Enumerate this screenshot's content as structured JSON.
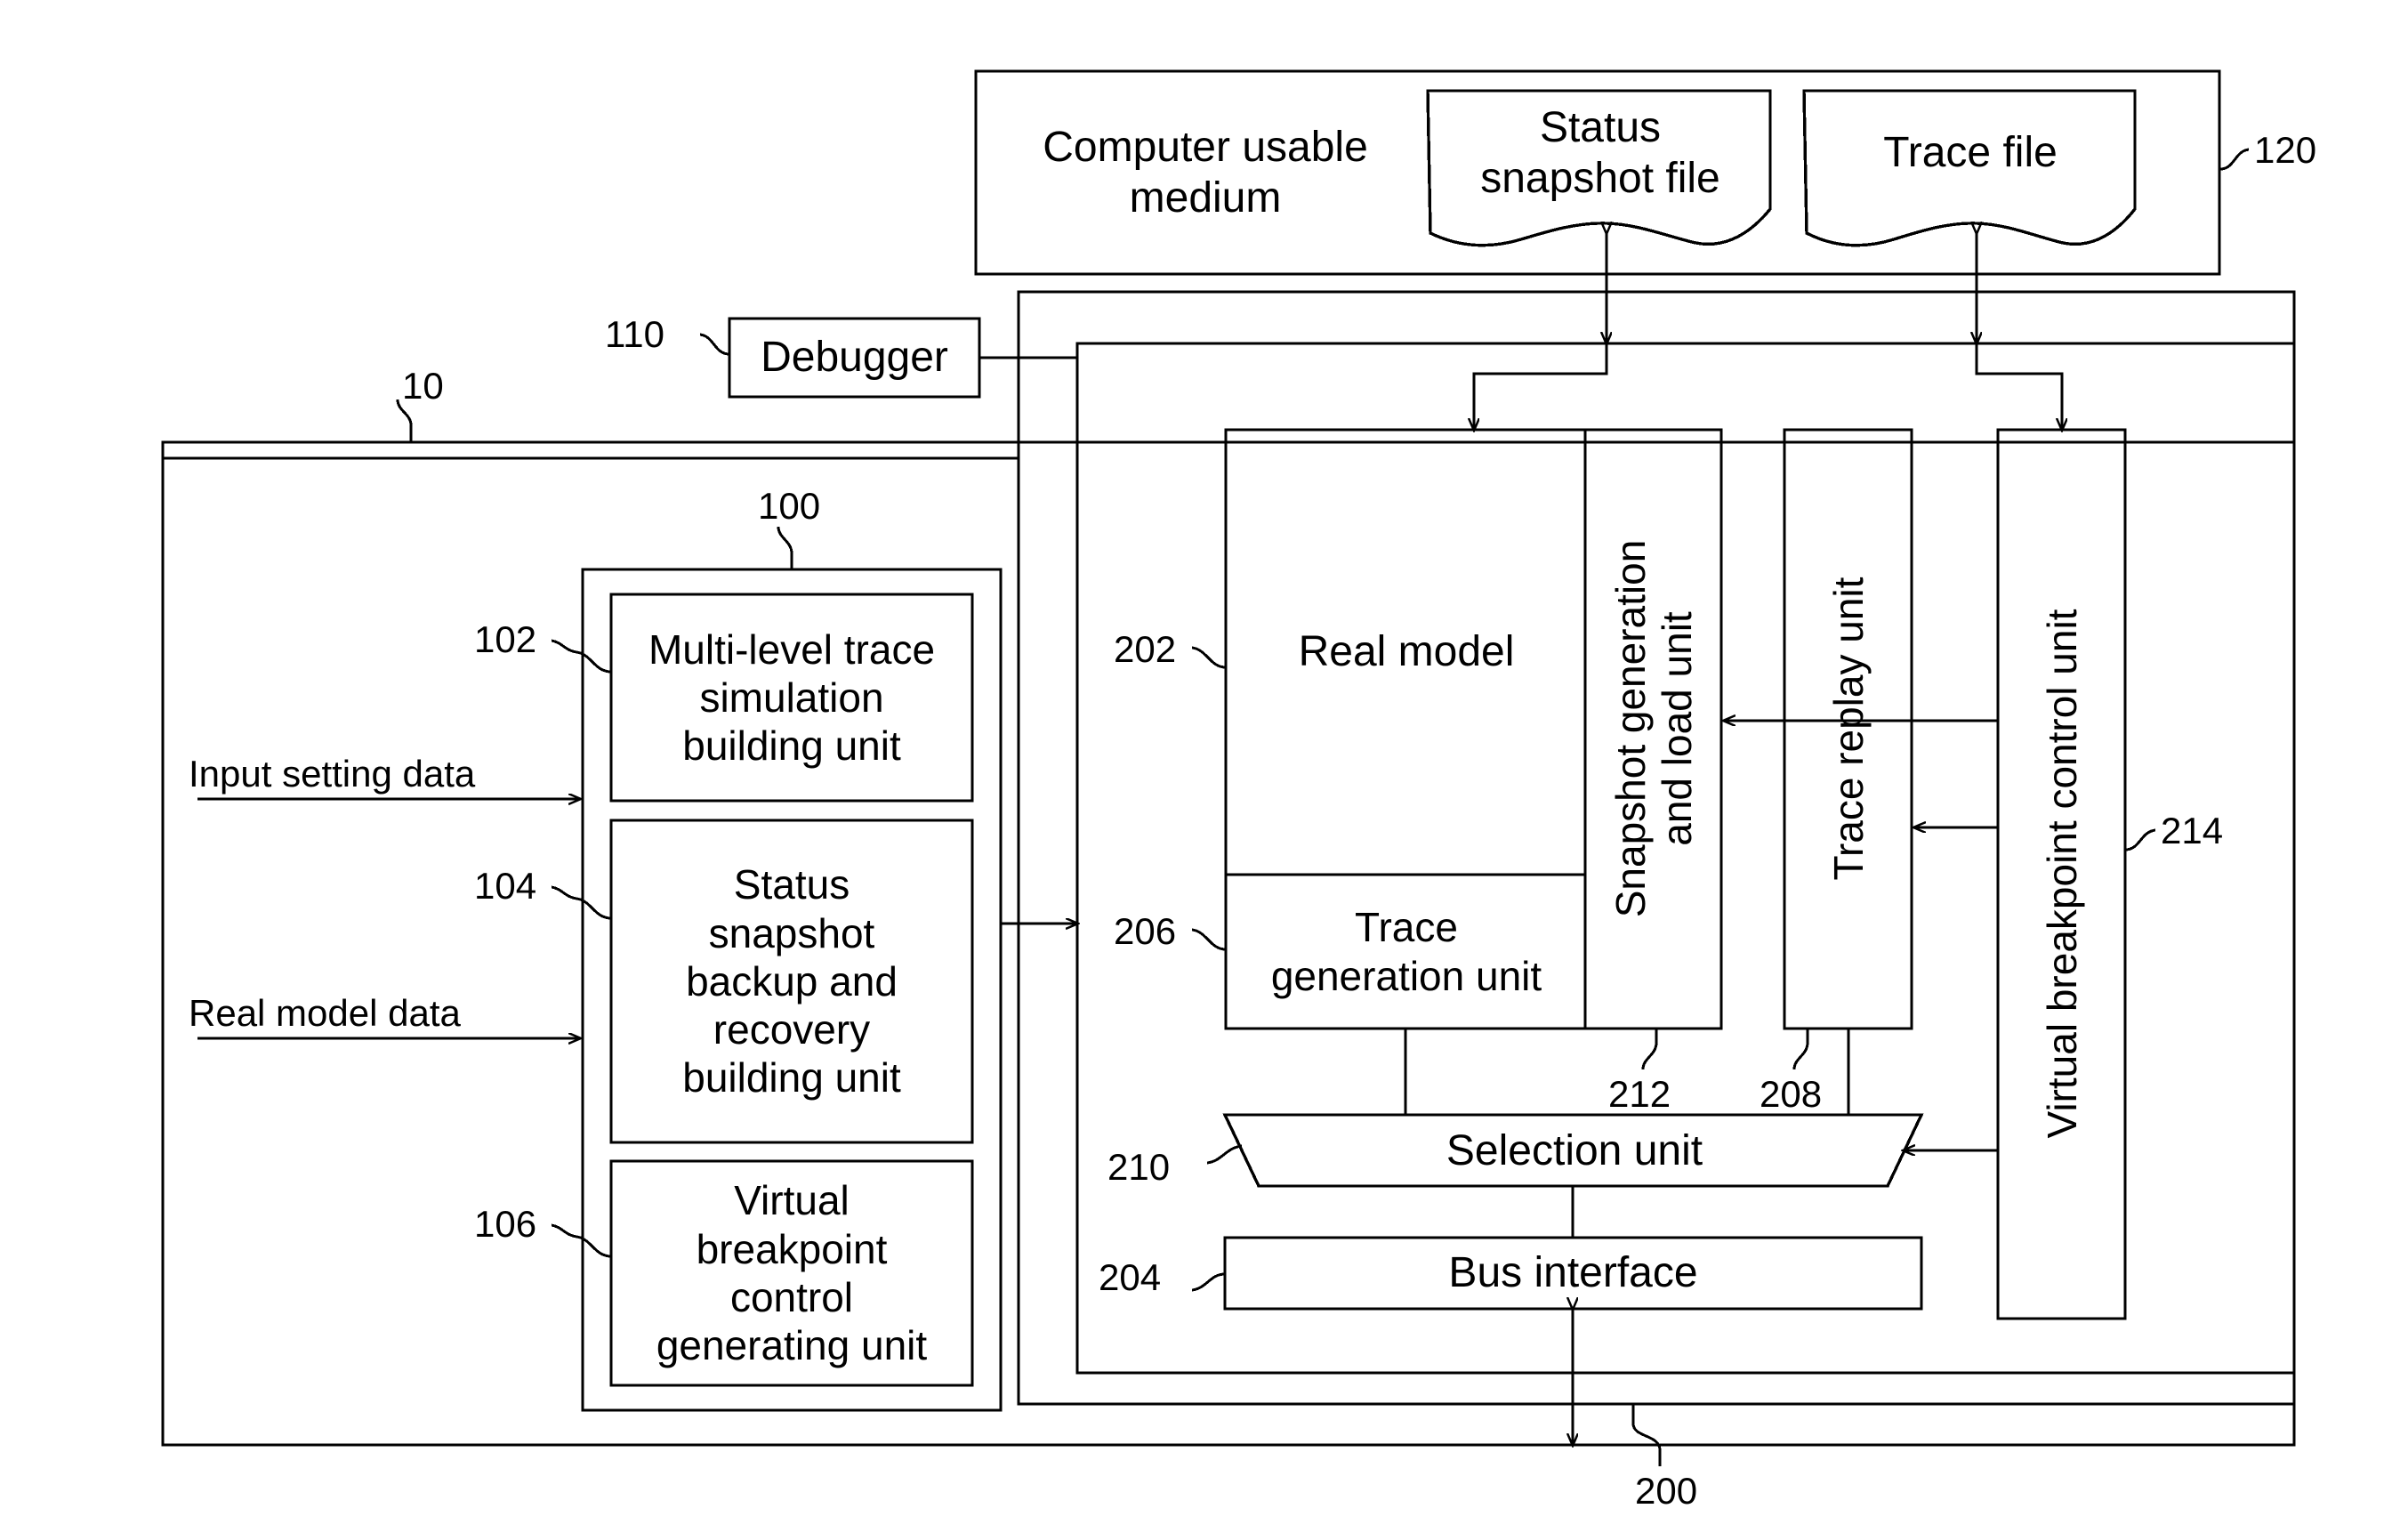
{
  "figure": {
    "type": "patent-block-diagram",
    "background": "#ffffff",
    "stroke": "#000000"
  },
  "boxes": {
    "computer_usable_medium": {
      "label": "Computer usable\nmedium",
      "ref": "120"
    },
    "status_snapshot_file": {
      "label": "Status\nsnapshot file"
    },
    "trace_file": {
      "label": "Trace file"
    },
    "debugger": {
      "label": "Debugger",
      "ref": "110"
    },
    "system": {
      "ref": "10"
    },
    "builder_group": {
      "ref": "100"
    },
    "multi_level_trace": {
      "label": "Multi-level trace\nsimulation\nbuilding unit",
      "ref": "102"
    },
    "status_snapshot_backup": {
      "label": "Status\nsnapshot\nbackup and\nrecovery\nbuilding unit",
      "ref": "104"
    },
    "virtual_breakpoint_gen": {
      "label": "Virtual\nbreakpoint\ncontrol\ngenerating unit",
      "ref": "106"
    },
    "simulation_platform": {
      "ref": "200"
    },
    "real_model": {
      "label": "Real model",
      "ref": "202"
    },
    "trace_generation_unit": {
      "label": "Trace\ngeneration unit",
      "ref": "206"
    },
    "snapshot_generation_load": {
      "label": "Snapshot generation\nand load unit",
      "ref": "212"
    },
    "trace_replay_unit": {
      "label": "Trace replay unit",
      "ref": "208"
    },
    "virtual_breakpoint_ctrl": {
      "label": "Virtual breakpoint control unit",
      "ref": "214"
    },
    "selection_unit": {
      "label": "Selection unit",
      "ref": "210"
    },
    "bus_interface": {
      "label": "Bus interface",
      "ref": "204"
    }
  },
  "flows": {
    "input_setting_data": "Input setting data",
    "real_model_data": "Real model data"
  },
  "refs": {
    "r10": "10",
    "r100": "100",
    "r102": "102",
    "r104": "104",
    "r106": "106",
    "r110": "110",
    "r120": "120",
    "r200": "200",
    "r202": "202",
    "r204": "204",
    "r206": "206",
    "r208": "208",
    "r210": "210",
    "r212": "212",
    "r214": "214"
  }
}
